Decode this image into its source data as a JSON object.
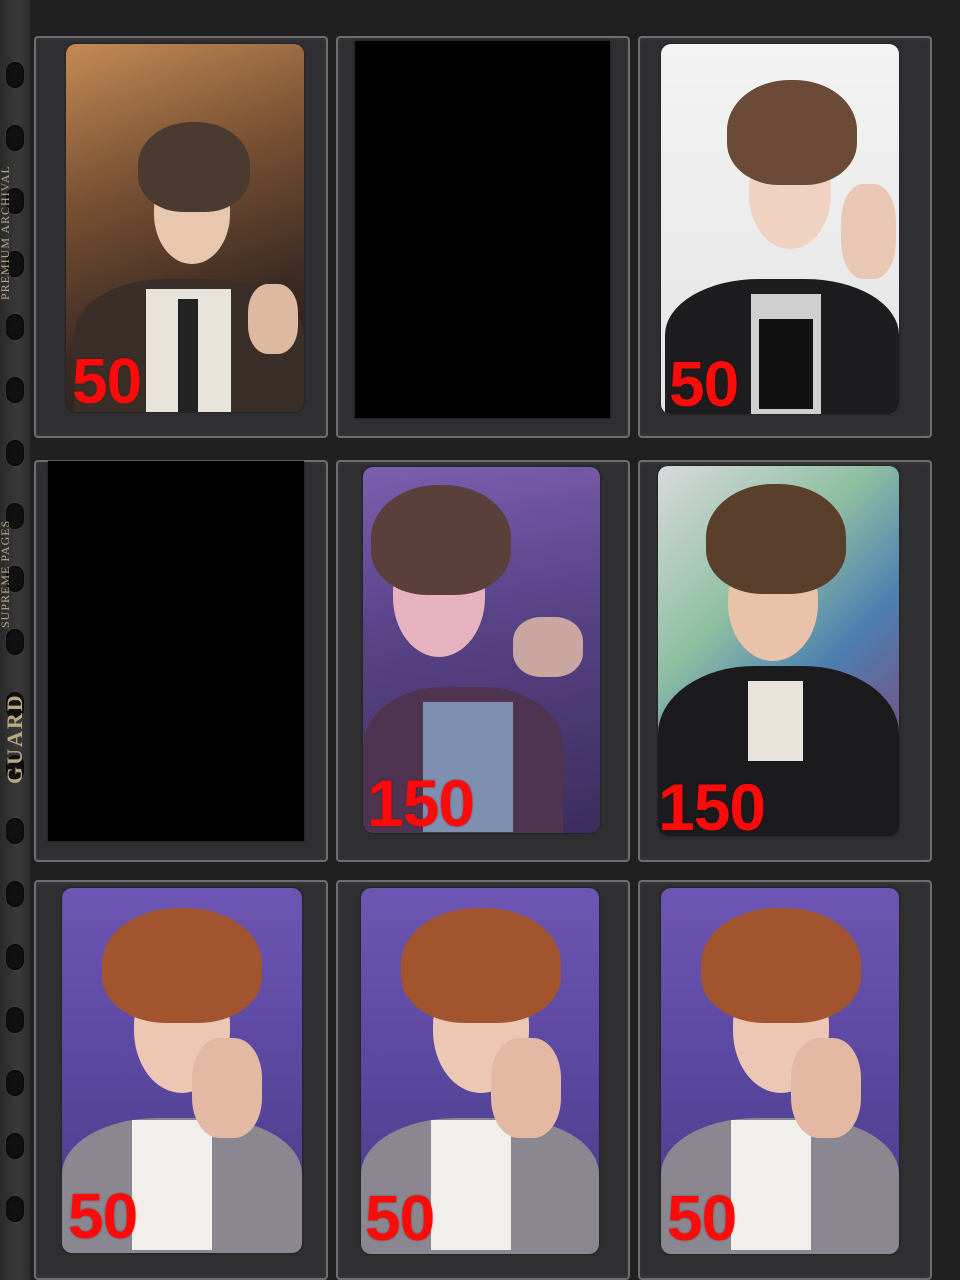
{
  "binder": {
    "brand": "GUARD",
    "product_line": "SUPREME PAGES",
    "small_print": "PREMIUM ARCHIVAL"
  },
  "cards": [
    {
      "slot": "r1c1",
      "price": "50",
      "censored": false,
      "theme": "night-street"
    },
    {
      "slot": "r1c2",
      "price": "",
      "censored": true,
      "theme": "censored"
    },
    {
      "slot": "r1c3",
      "price": "50",
      "censored": false,
      "theme": "white-studio"
    },
    {
      "slot": "r2c1",
      "price": "",
      "censored": true,
      "theme": "censored"
    },
    {
      "slot": "r2c2",
      "price": "150",
      "censored": false,
      "theme": "purple-selfie"
    },
    {
      "slot": "r2c3",
      "price": "150",
      "censored": false,
      "theme": "graffiti-wall"
    },
    {
      "slot": "r3c1",
      "price": "50",
      "censored": false,
      "theme": "purple-portrait"
    },
    {
      "slot": "r3c2",
      "price": "50",
      "censored": false,
      "theme": "purple-portrait"
    },
    {
      "slot": "r3c3",
      "price": "50",
      "censored": false,
      "theme": "purple-portrait"
    }
  ],
  "colors": {
    "price_text": "#ff0a0a",
    "background": "#202021",
    "censor_block": "#000000"
  }
}
